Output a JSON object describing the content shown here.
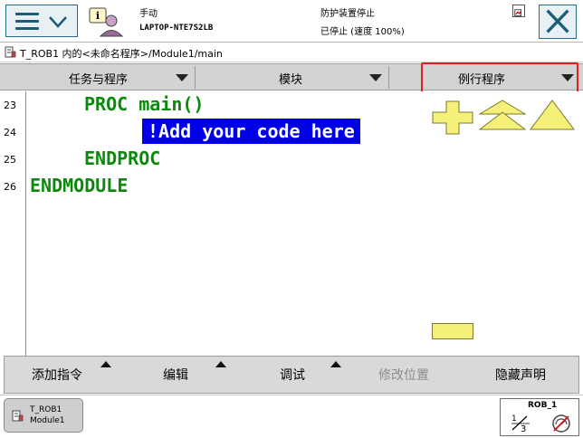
{
  "status": {
    "mode": "手动",
    "controller": "LAPTOP-NTE7S2LB",
    "safety": "防护装置停止",
    "run_state": "已停止 (速度 100%)"
  },
  "path": "T_ROB1 内的<未命名程序>/Module1/main",
  "tabs": [
    {
      "label": "任务与程序"
    },
    {
      "label": "模块"
    },
    {
      "label": "例行程序"
    }
  ],
  "code": {
    "line_numbers": [
      "23",
      "24",
      "25",
      "26"
    ],
    "lines": [
      "PROC main()",
      "!Add your code here",
      "ENDPROC",
      "ENDMODULE"
    ]
  },
  "toolbar": {
    "add_instruction": "添加指令",
    "edit": "编辑",
    "debug": "调试",
    "modify_position": "修改位置",
    "hide_declarations": "隐藏声明"
  },
  "taskbar": {
    "task_name": "T_ROB1",
    "task_module": "Module1",
    "robot_label": "ROB_1"
  },
  "colors": {
    "code_green": "#0a8a0a",
    "selection_blue": "#0000e6",
    "highlight_red": "#e02020",
    "button_yellow": "#f5f07a"
  },
  "icons": [
    "menu-icon",
    "chevron-down-icon",
    "operator-icon",
    "monitor-icon",
    "close-icon",
    "program-icon",
    "plus-icon",
    "scroll-up-icon",
    "page-up-icon",
    "minus-icon",
    "robot-increment-icon",
    "speed-icon"
  ]
}
